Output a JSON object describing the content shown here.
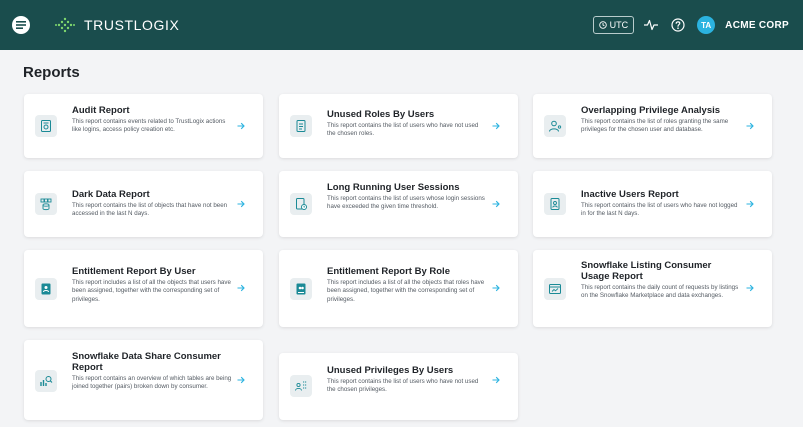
{
  "topbar": {
    "brand": "TRUSTLOGIX",
    "timezone": "UTC",
    "avatar_initials": "TA",
    "org_name": "ACME CORP"
  },
  "page": {
    "title": "Reports"
  },
  "colors": {
    "topbar": "#1a4d4d",
    "accent": "#2bb3e0",
    "icon_teal": "#1a8a96",
    "icon_bg": "#e9eef0"
  },
  "reports": [
    {
      "title": "Audit Report",
      "description": "This report contains events related to TrustLogix actions like logins, access policy creation etc.",
      "icon": "audit-icon"
    },
    {
      "title": "Unused Roles By Users",
      "description": "This report contains the list of users who have not used the chosen roles.",
      "icon": "document-icon"
    },
    {
      "title": "Overlapping Privilege Analysis",
      "description": "This report contains the list of roles granting the same privileges for the chosen user and database.",
      "icon": "users-key-icon"
    },
    {
      "title": "Dark Data Report",
      "description": "This report contains the list of objects that have not been accessed in the last N days.",
      "icon": "database-icon"
    },
    {
      "title": "Long Running User Sessions",
      "description": "This report contains the list of users whose login sessions have exceeded the given time threshold.",
      "icon": "clock-document-icon"
    },
    {
      "title": "Inactive Users Report",
      "description": "This report contains the list of users who have not logged in for the last N days.",
      "icon": "user-document-icon"
    },
    {
      "title": "Entitlement Report By User",
      "description": "This report includes a list of all the objects that users have been assigned, together with the corresponding set of privileges.",
      "icon": "user-entitlement-icon"
    },
    {
      "title": "Entitlement Report By Role",
      "description": "This report includes a list of all the objects that roles have been assigned, together with the corresponding set of privileges.",
      "icon": "role-entitlement-icon"
    },
    {
      "title": "Snowflake Listing Consumer Usage Report",
      "description": "This report contains the daily count of requests by listings on the Snowflake Marketplace and data exchanges.",
      "icon": "browser-chart-icon"
    },
    {
      "title": "Snowflake Data Share Consumer Report",
      "description": "This report contains an overview of which tables are being joined together (pairs) broken down by consumer.",
      "icon": "chart-search-icon"
    },
    {
      "title": "Unused Privileges By Users",
      "description": "This report contains the list of users who have not used the chosen privileges.",
      "icon": "user-list-icon"
    }
  ]
}
